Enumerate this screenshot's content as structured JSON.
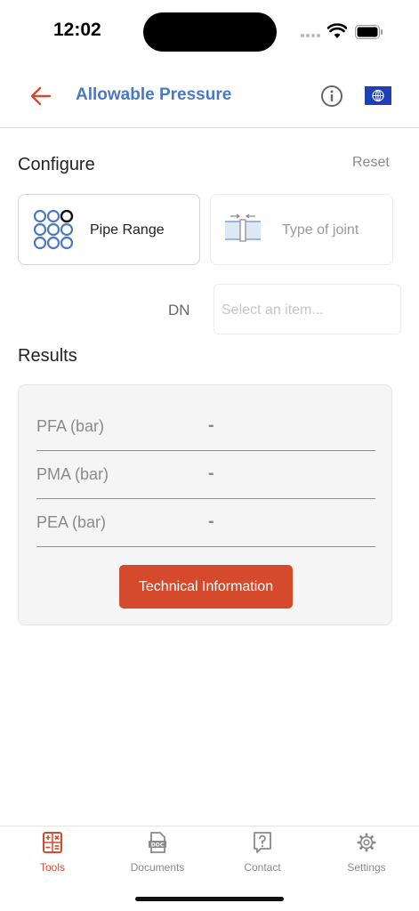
{
  "status_bar": {
    "time": "12:02"
  },
  "header": {
    "title": "Allowable Pressure"
  },
  "configure": {
    "title": "Configure",
    "reset_label": "Reset",
    "pipe_range_label": "Pipe Range",
    "joint_type_label": "Type of joint",
    "dn_label": "DN",
    "dn_placeholder": "Select an item..."
  },
  "results": {
    "title": "Results",
    "rows": [
      {
        "label": "PFA (bar)",
        "value": "-"
      },
      {
        "label": "PMA (bar)",
        "value": "-"
      },
      {
        "label": "PEA (bar)",
        "value": "-"
      }
    ],
    "button_label": "Technical Information"
  },
  "tabs": [
    {
      "label": "Tools",
      "active": true
    },
    {
      "label": "Documents",
      "active": false
    },
    {
      "label": "Contact",
      "active": false
    },
    {
      "label": "Settings",
      "active": false
    }
  ],
  "colors": {
    "accent": "#d54a2c",
    "title_blue": "#4a78c2",
    "pipe_blue": "#4a78c2"
  }
}
